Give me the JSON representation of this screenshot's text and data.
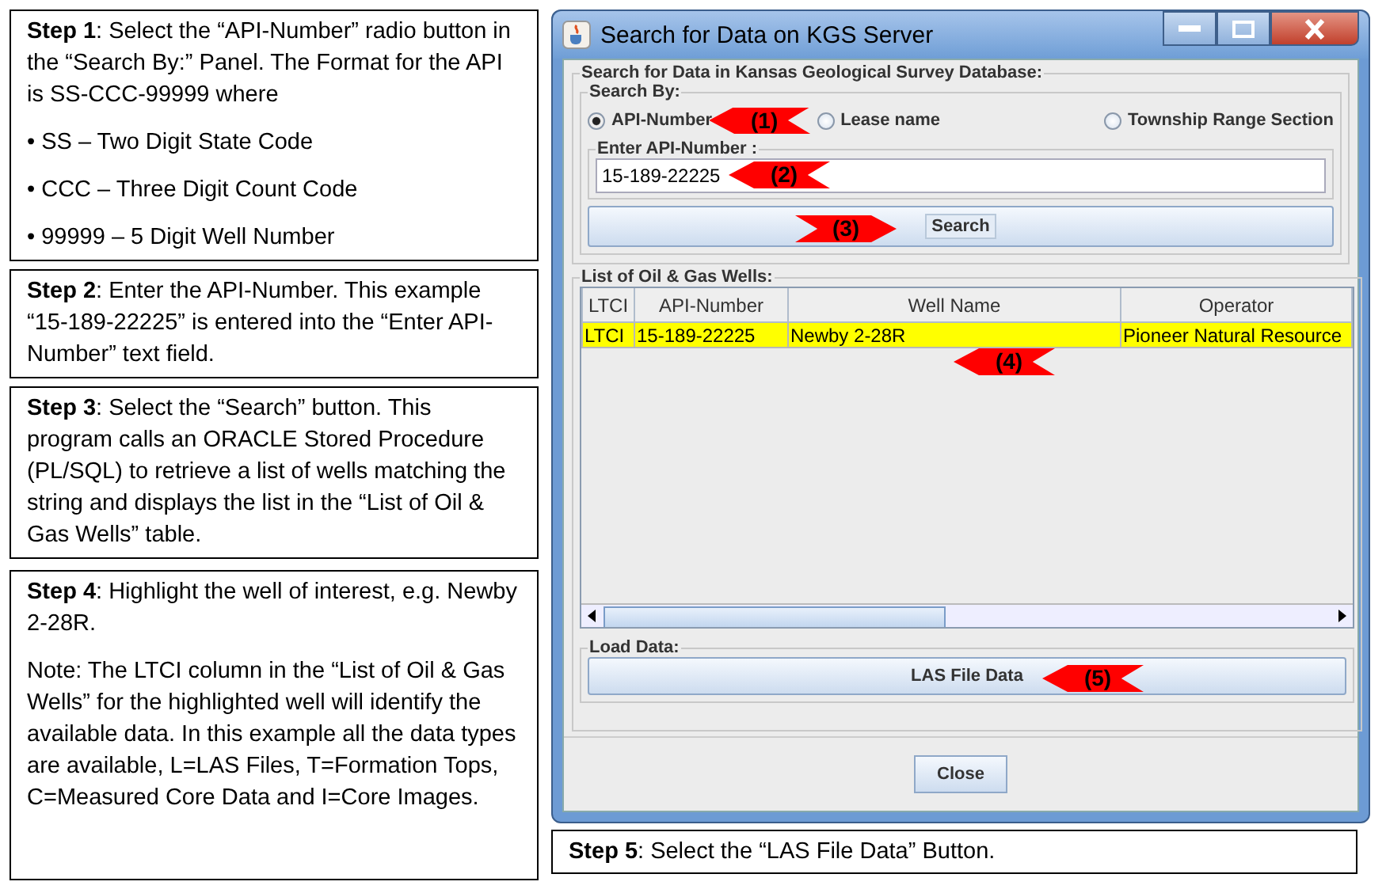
{
  "steps": [
    {
      "paragraphs": [
        "**Step 1**: Select the “API-Number” radio button in the “Search By:” Panel.  The Format for the API is SS-CCC-99999 where",
        "• SS – Two Digit State Code",
        "• CCC – Three Digit Count Code",
        "• 99999 – 5 Digit Well Number"
      ]
    },
    {
      "paragraphs": [
        "**Step 2**: Enter the API-Number. This example “15-189-22225” is entered into the “Enter API-Number” text field."
      ]
    },
    {
      "paragraphs": [
        "**Step 3**: Select the “Search” button.  This program calls an ORACLE Stored Procedure (PL/SQL) to retrieve a list of wells matching the string and displays the list in the “List of Oil & Gas Wells” table."
      ]
    },
    {
      "paragraphs": [
        "**Step 4**: Highlight the well of interest, e.g. Newby 2-28R.",
        "Note: The LTCI column in the “List of Oil & Gas Wells” for the highlighted well will identify the available data. In this example all the data types are available, L=LAS Files, T=Formation Tops, C=Measured Core Data and I=Core Images."
      ]
    }
  ],
  "window": {
    "title": "Search for Data on KGS Server",
    "panel_title": "Search for Data in Kansas Geological Survey Database:",
    "search_by": {
      "title": "Search By:",
      "options": [
        {
          "label": "API-Number",
          "selected": true
        },
        {
          "label": "Lease name",
          "selected": false
        },
        {
          "label": "Township Range Section",
          "selected": false
        }
      ]
    },
    "field": {
      "label": "Enter API-Number :",
      "value": "15-189-22225"
    },
    "search_button": "Search",
    "wells": {
      "title": "List of Oil & Gas Wells:",
      "columns": [
        "LTCI",
        "API-Number",
        "Well Name",
        "Operator"
      ],
      "rows": [
        {
          "cells": [
            "LTCI",
            "15-189-22225",
            "Newby 2-28R",
            "Pioneer Natural Resource"
          ],
          "selected": true
        }
      ]
    },
    "load": {
      "title": "Load Data:",
      "button": "LAS File Data"
    },
    "close_button": "Close"
  },
  "callouts": [
    "(1)",
    "(2)",
    "(3)",
    "(4)",
    "(5)"
  ],
  "step5": "**Step 5**: Select the “LAS File Data” Button."
}
